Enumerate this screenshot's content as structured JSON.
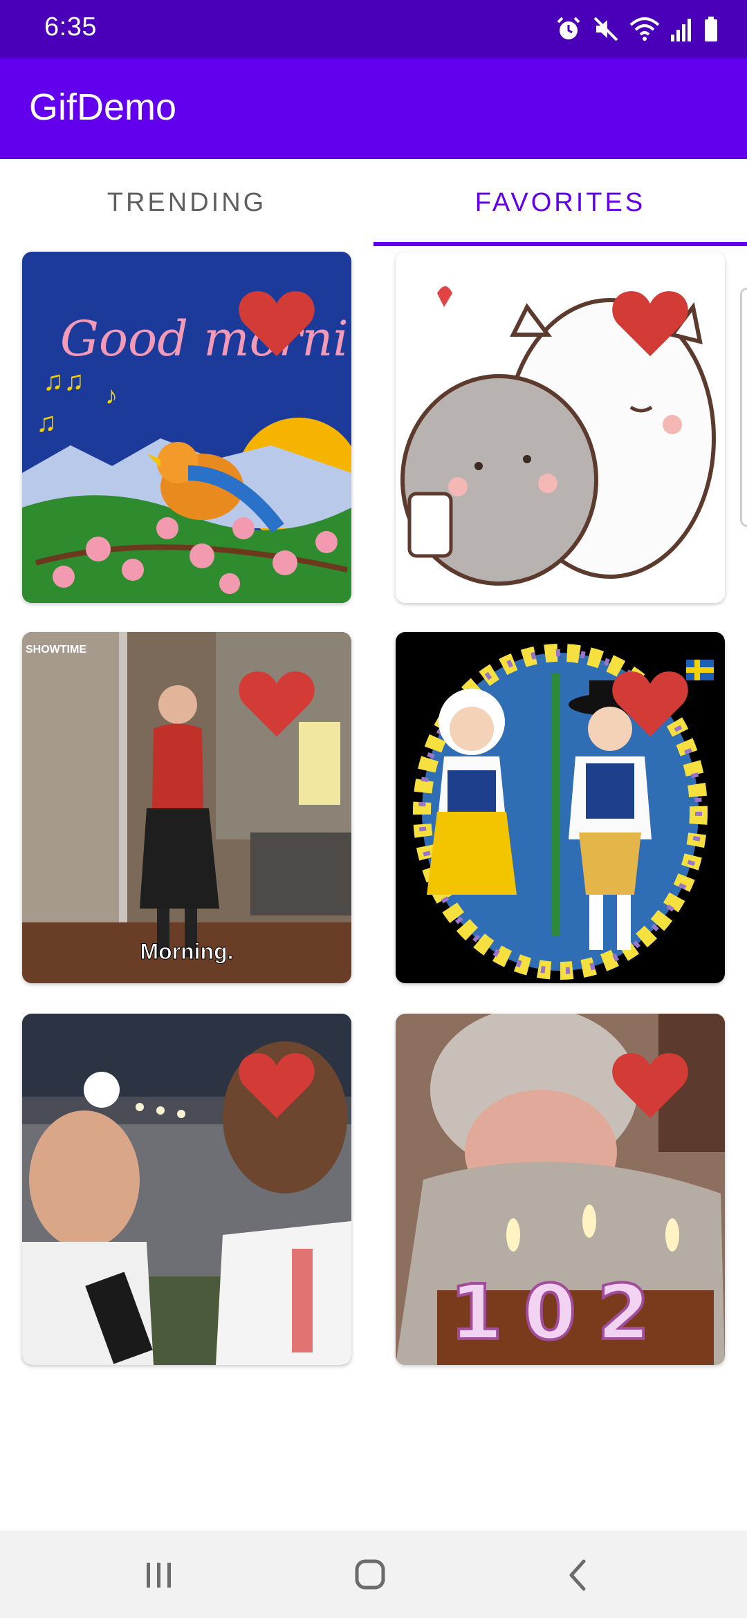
{
  "status_bar": {
    "time": "6:35",
    "icons": [
      "alarm-icon",
      "mute-icon",
      "wifi-icon",
      "signal-icon",
      "battery-icon"
    ]
  },
  "app_bar": {
    "title": "GifDemo",
    "color": "#6200ee"
  },
  "tabs": [
    {
      "label": "TRENDING",
      "active": false
    },
    {
      "label": "FAVORITES",
      "active": true
    }
  ],
  "gifs": [
    {
      "caption": "Good morning",
      "favorited": true
    },
    {
      "caption": "",
      "favorited": true
    },
    {
      "caption": "Morning.",
      "watermark": "SHOWTIME",
      "favorited": true
    },
    {
      "caption": "",
      "favorited": true
    },
    {
      "caption": "",
      "favorited": true
    },
    {
      "caption": "102",
      "favorited": true
    }
  ],
  "nav": {
    "buttons": [
      "recent-apps-icon",
      "home-icon",
      "back-icon"
    ]
  },
  "colors": {
    "accent": "#6200ee",
    "status_bar": "#4a00b8",
    "heart": "#d23b36"
  }
}
